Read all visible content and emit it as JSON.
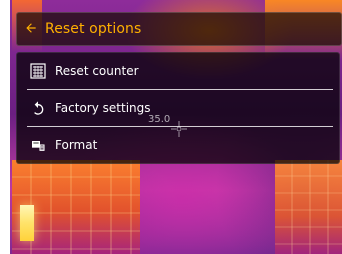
{
  "header": {
    "title": "Reset options"
  },
  "menu": {
    "items": [
      {
        "label": "Reset counter",
        "icon": "counter-icon"
      },
      {
        "label": "Factory settings",
        "icon": "refresh-icon"
      },
      {
        "label": "Format",
        "icon": "format-icon"
      }
    ]
  },
  "thermal": {
    "readout": "35.0"
  },
  "colors": {
    "accent": "#ffb000",
    "menu_bg": "#000000",
    "text": "#ffffff"
  }
}
